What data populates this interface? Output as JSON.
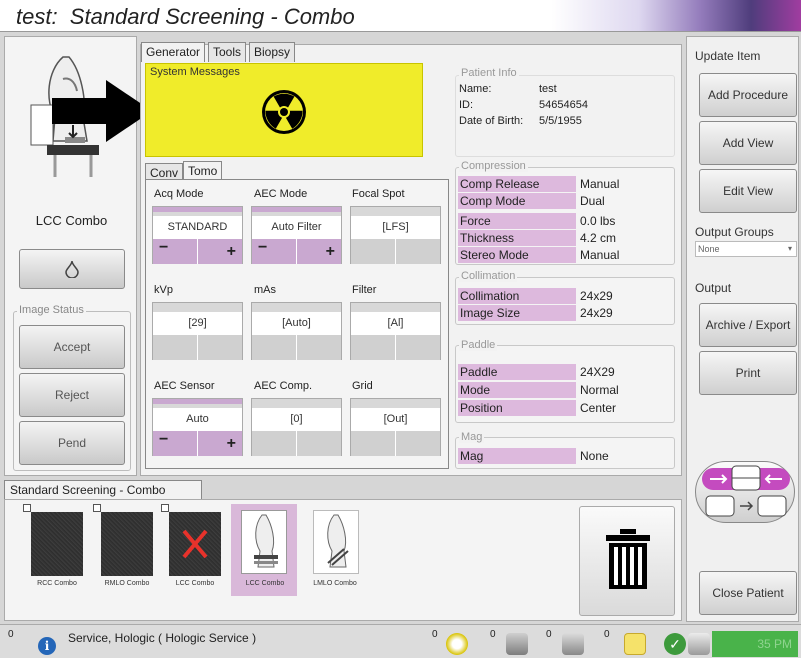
{
  "title": "test:  Standard Screening - Combo",
  "left": {
    "view_name": "LCC Combo",
    "image_status_label": "Image Status",
    "accept": "Accept",
    "reject": "Reject",
    "pend": "Pend",
    "drop_icon": "drop-icon"
  },
  "tabs": [
    "Generator",
    "Tools",
    "Biopsy"
  ],
  "system_messages": {
    "label": "System Messages",
    "icon": "radiation-icon"
  },
  "mode_tabs": [
    "Conv",
    "Tomo"
  ],
  "params": {
    "acq_mode": {
      "label": "Acq Mode",
      "value": "STANDARD"
    },
    "aec_mode": {
      "label": "AEC Mode",
      "value": "Auto Filter"
    },
    "focal_spot": {
      "label": "Focal Spot",
      "value": "[LFS]"
    },
    "kvp": {
      "label": "kVp",
      "value": "[29]"
    },
    "mas": {
      "label": "mAs",
      "value": "[Auto]"
    },
    "filter": {
      "label": "Filter",
      "value": "[Al]"
    },
    "aec_sensor": {
      "label": "AEC Sensor",
      "value": "Auto"
    },
    "aec_comp": {
      "label": "AEC Comp.",
      "value": "[0]"
    },
    "grid": {
      "label": "Grid",
      "value": "[Out]"
    },
    "minus": "−",
    "plus": "+"
  },
  "patient_info": {
    "label": "Patient Info",
    "name_label": "Name:",
    "name": "test",
    "id_label": "ID:",
    "id": "54654654",
    "dob_label": "Date of Birth:",
    "dob": "5/5/1955"
  },
  "compression": {
    "label": "Compression",
    "rows": [
      {
        "k": "Comp Release",
        "v": "Manual"
      },
      {
        "k": "Comp Mode",
        "v": "Dual"
      },
      {
        "k": "Force",
        "v": "0.0 lbs"
      },
      {
        "k": "Thickness",
        "v": "4.2 cm"
      },
      {
        "k": "Stereo Mode",
        "v": "Manual"
      }
    ]
  },
  "collimation": {
    "label": "Collimation",
    "rows": [
      {
        "k": "Collimation",
        "v": "24x29"
      },
      {
        "k": "Image Size",
        "v": "24x29"
      }
    ]
  },
  "paddle": {
    "label": "Paddle",
    "rows": [
      {
        "k": "Paddle",
        "v": "24X29"
      },
      {
        "k": "Mode",
        "v": "Normal"
      },
      {
        "k": "Position",
        "v": "Center"
      }
    ]
  },
  "mag": {
    "label": "Mag",
    "rows": [
      {
        "k": "Mag",
        "v": "None"
      }
    ]
  },
  "right": {
    "update_item": "Update Item",
    "add_procedure": "Add Procedure",
    "add_view": "Add View",
    "edit_view": "Edit View",
    "output_groups": "Output Groups",
    "output_groups_value": "None",
    "output": "Output",
    "archive_export": "Archive / Export",
    "print": "Print",
    "close_patient": "Close Patient"
  },
  "procedure_tab": "Standard Screening - Combo",
  "thumbnails": [
    {
      "caption": "RCC Combo"
    },
    {
      "caption": "RMLO Combo"
    },
    {
      "caption": "LCC Combo"
    },
    {
      "caption": "LCC Combo"
    },
    {
      "caption": "LMLO Combo"
    }
  ],
  "status": {
    "count0": "0",
    "service": "Service, Hologic ( Hologic Service )",
    "counts": [
      "0",
      "0",
      "0",
      "0"
    ],
    "clock": "35 PM"
  },
  "colors": {
    "violet": "#ddb9dd",
    "yellow": "#f0ec2a",
    "green": "#49b34a"
  }
}
